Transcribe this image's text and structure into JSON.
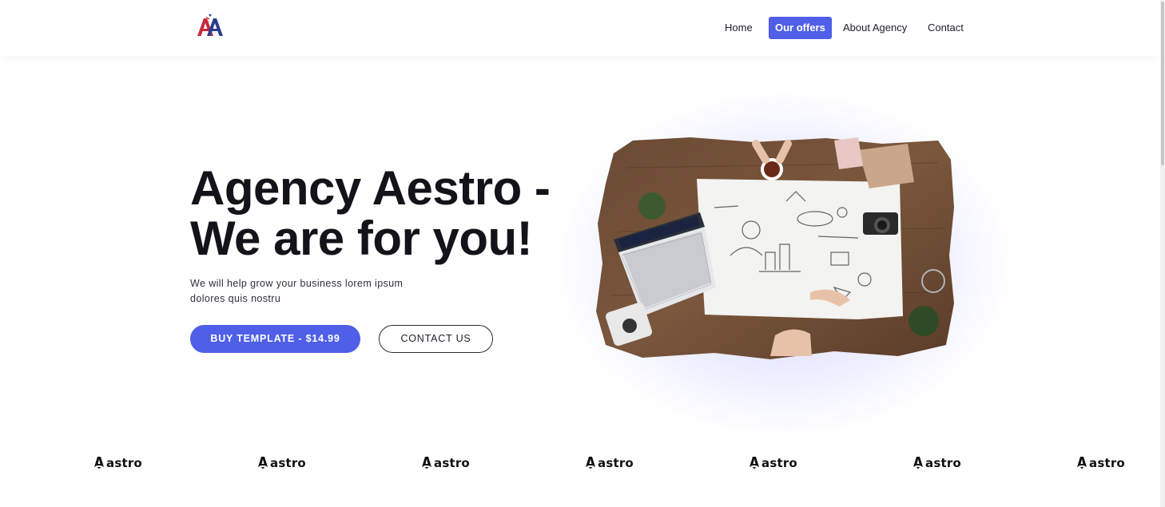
{
  "nav": {
    "items": [
      {
        "label": "Home",
        "active": false
      },
      {
        "label": "Our offers",
        "active": true
      },
      {
        "label": "About Agency",
        "active": false
      },
      {
        "label": "Contact",
        "active": false
      }
    ]
  },
  "hero": {
    "title_line1": "Agency Aestro -",
    "title_line2": "We are for you!",
    "subtitle_line1": "We will help grow your business lorem ipsum",
    "subtitle_line2": "dolores quis nostru",
    "buy_button": "BUY TEMPLATE - $14.99",
    "contact_button": "CONTACT US"
  },
  "brands": {
    "items": [
      "astro",
      "astro",
      "astro",
      "astro",
      "astro",
      "astro",
      "astro"
    ]
  },
  "colors": {
    "accent": "#4f5fe8",
    "logo_red": "#c8283c",
    "logo_blue": "#2a3d8f"
  }
}
